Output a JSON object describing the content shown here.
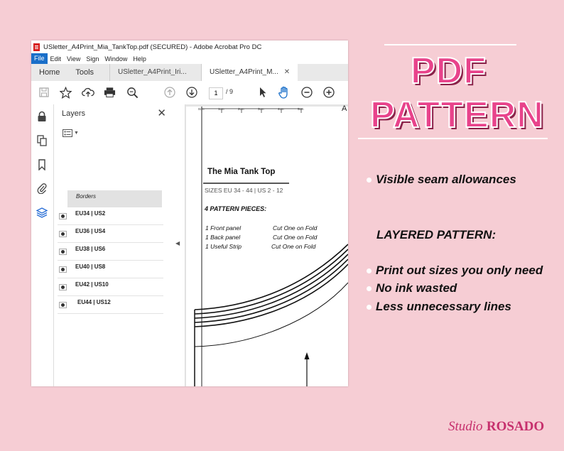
{
  "acrobat": {
    "window_title": "USletter_A4Print_Mia_TankTop.pdf (SECURED) - Adobe Acrobat Pro DC",
    "menu": [
      "File",
      "Edit",
      "View",
      "Sign",
      "Window",
      "Help"
    ],
    "tabs": {
      "home": "Home",
      "tools": "Tools",
      "doc1": "USletter_A4Print_Iri...",
      "doc2": "USletter_A4Print_M..."
    },
    "page_current": "1",
    "page_total": "/ 9",
    "layers_panel": {
      "title": "Layers",
      "items": [
        "Borders",
        "EU34 | US2",
        "EU36 | US4",
        "EU38 | US6",
        "EU40 | US8",
        "EU42 | US10",
        "EU44 | US12"
      ]
    },
    "document": {
      "ruler_labels": [
        "0cm",
        "1cm",
        "2cm",
        "3cm",
        "4cm",
        "5cm"
      ],
      "corner_label": "A",
      "pattern_title": "The Mia Tank Top",
      "sizes": "SIZES EU 34 - 44 | US 2 - 12",
      "pieces_heading": "4 PATTERN PIECES:",
      "pieces": [
        {
          "name": "1 Front panel",
          "note": "Cut One on Fold"
        },
        {
          "name": "1 Back panel",
          "note": "Cut One on Fold"
        },
        {
          "name": "1 Useful Strip",
          "note": "Cut One on Fold"
        }
      ]
    }
  },
  "promo": {
    "title_line1": "PDF",
    "title_line2": "PATTERN",
    "bullet1": "Visible seam allowances",
    "section_heading": "LAYERED PATTERN:",
    "bullets": [
      "Print out sizes you only need",
      "No ink wasted",
      "Less unnecessary lines"
    ],
    "brand_script": "Studio",
    "brand_name": "ROSADO",
    "colors": {
      "background": "#f6cdd4",
      "accent": "#e8438b",
      "shadow": "#8a2149",
      "acrobat_blue": "#1a6fc9",
      "layers_active_icon": "#2a6fd6"
    }
  }
}
